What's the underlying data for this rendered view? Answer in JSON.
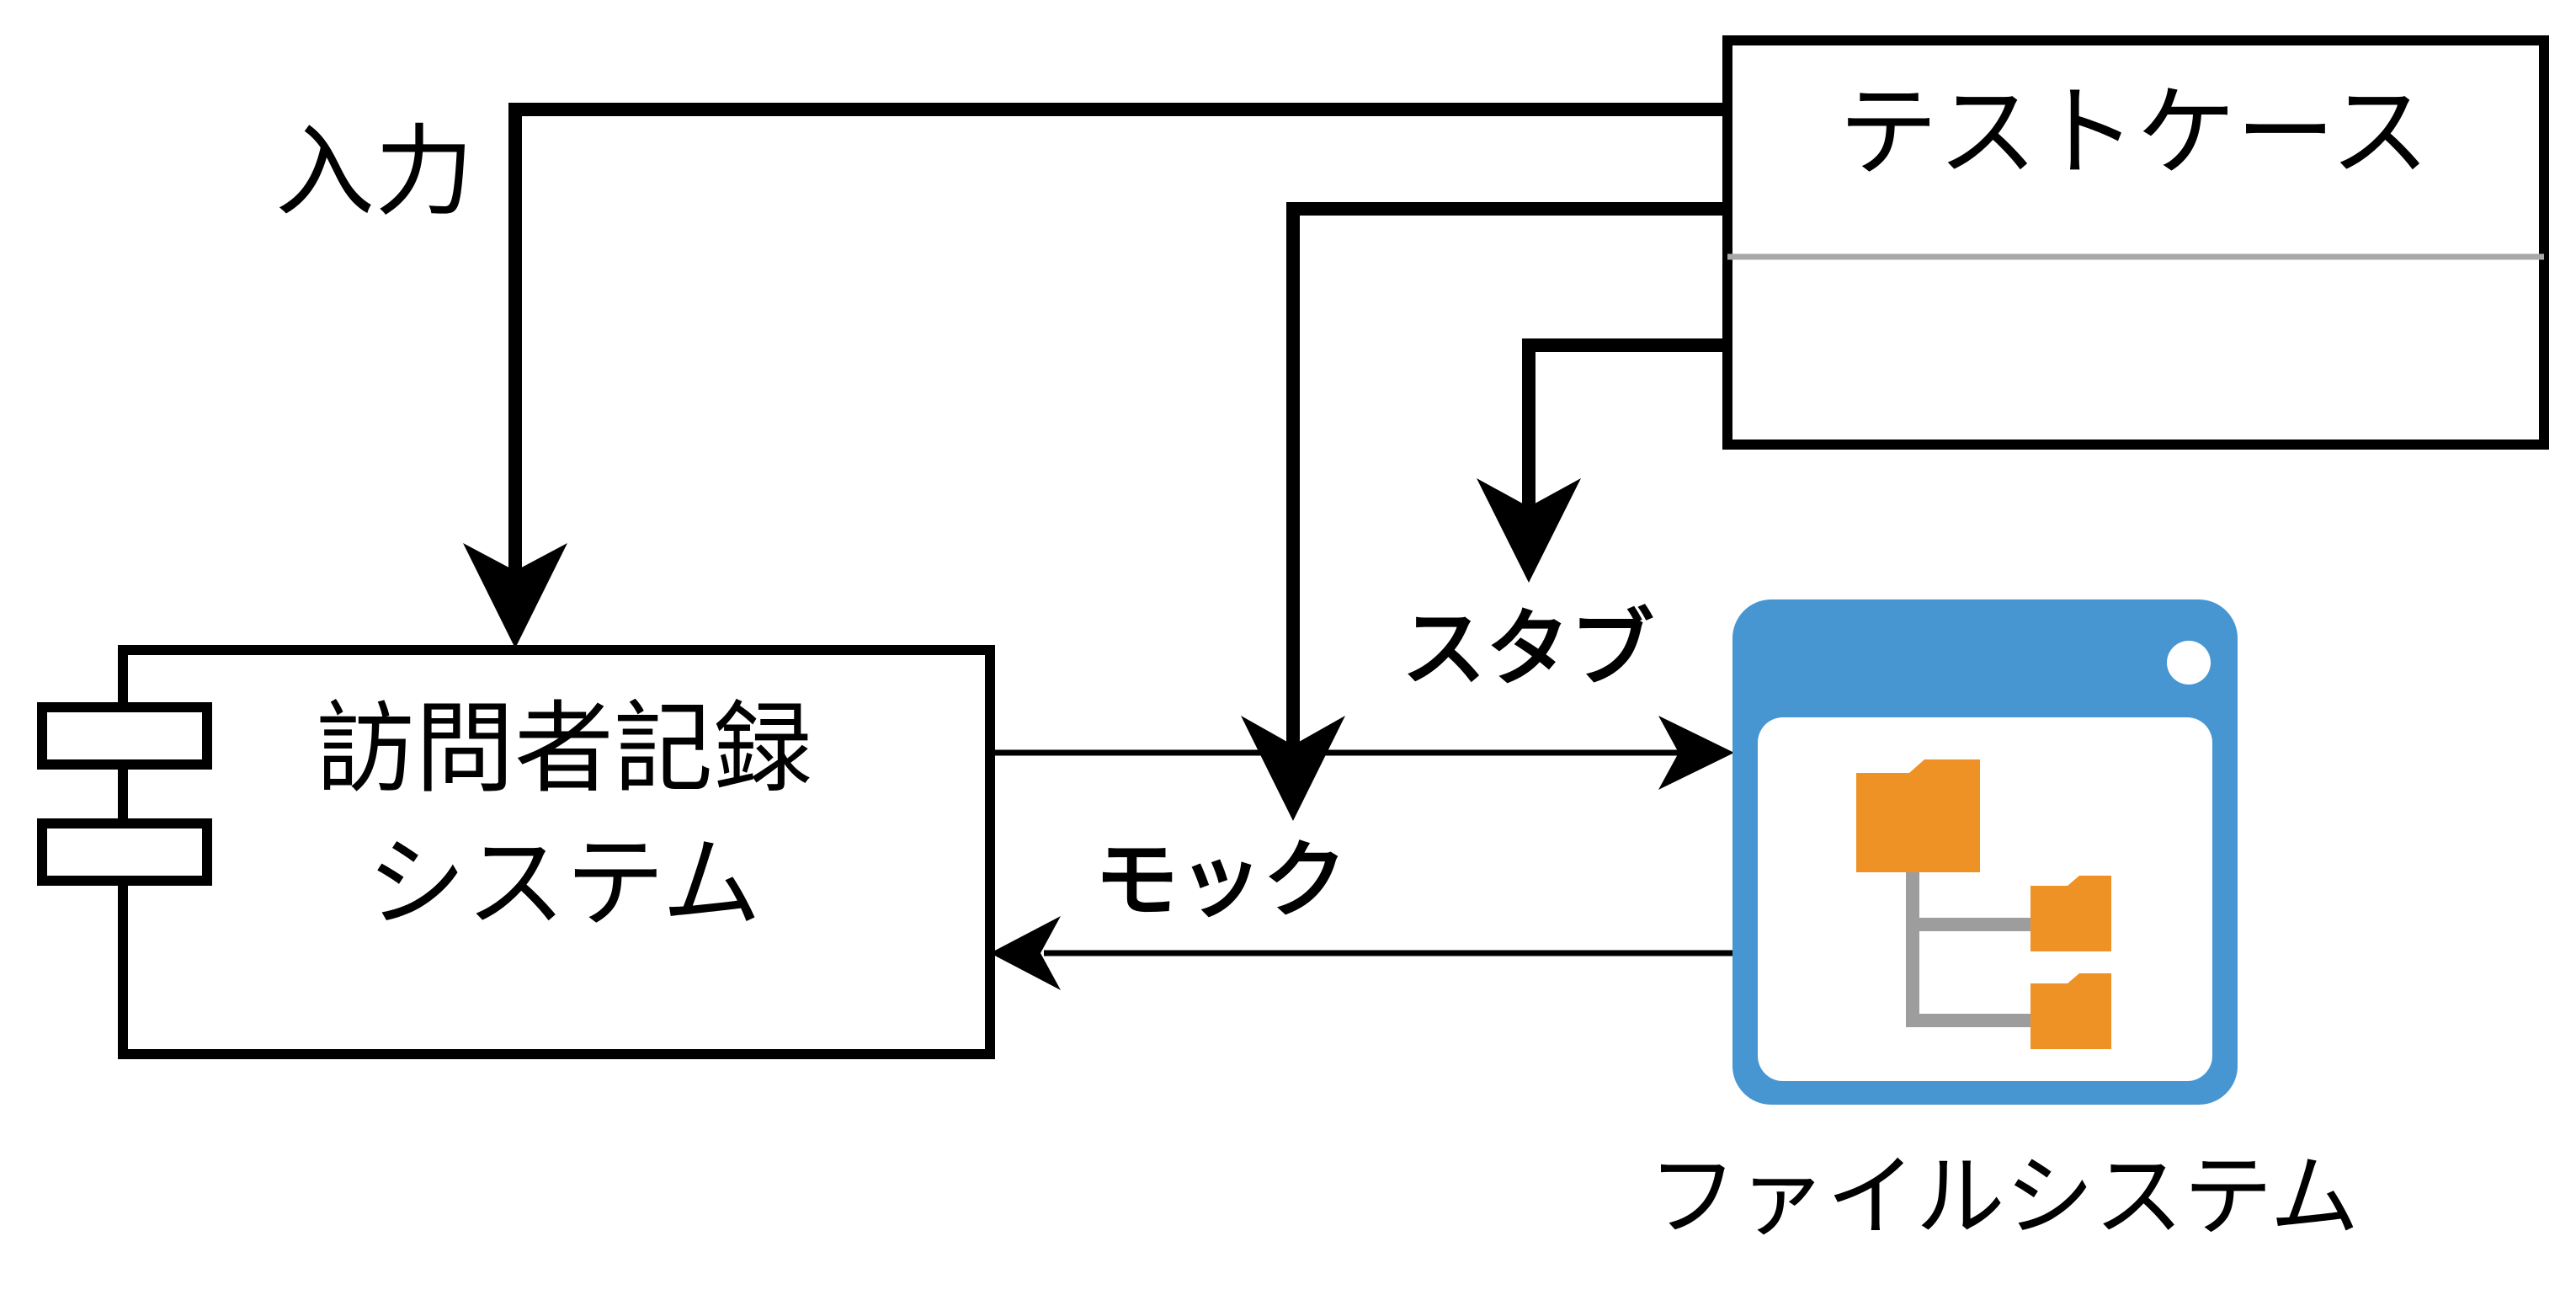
{
  "labels": {
    "input": "入力",
    "test_case": "テストケース",
    "system_line1": "訪問者記録",
    "system_line2": "システム",
    "stub": "スタブ",
    "mock": "モック",
    "file_system": "ファイルシステム"
  },
  "colors": {
    "stroke": "#000000",
    "window_blue": "#4796d2",
    "folder_orange": "#ee9225",
    "tree_gray": "#9d9d9d"
  },
  "icons": {
    "component": "uml-component-icon",
    "file_system": "folder-tree-window-icon"
  }
}
